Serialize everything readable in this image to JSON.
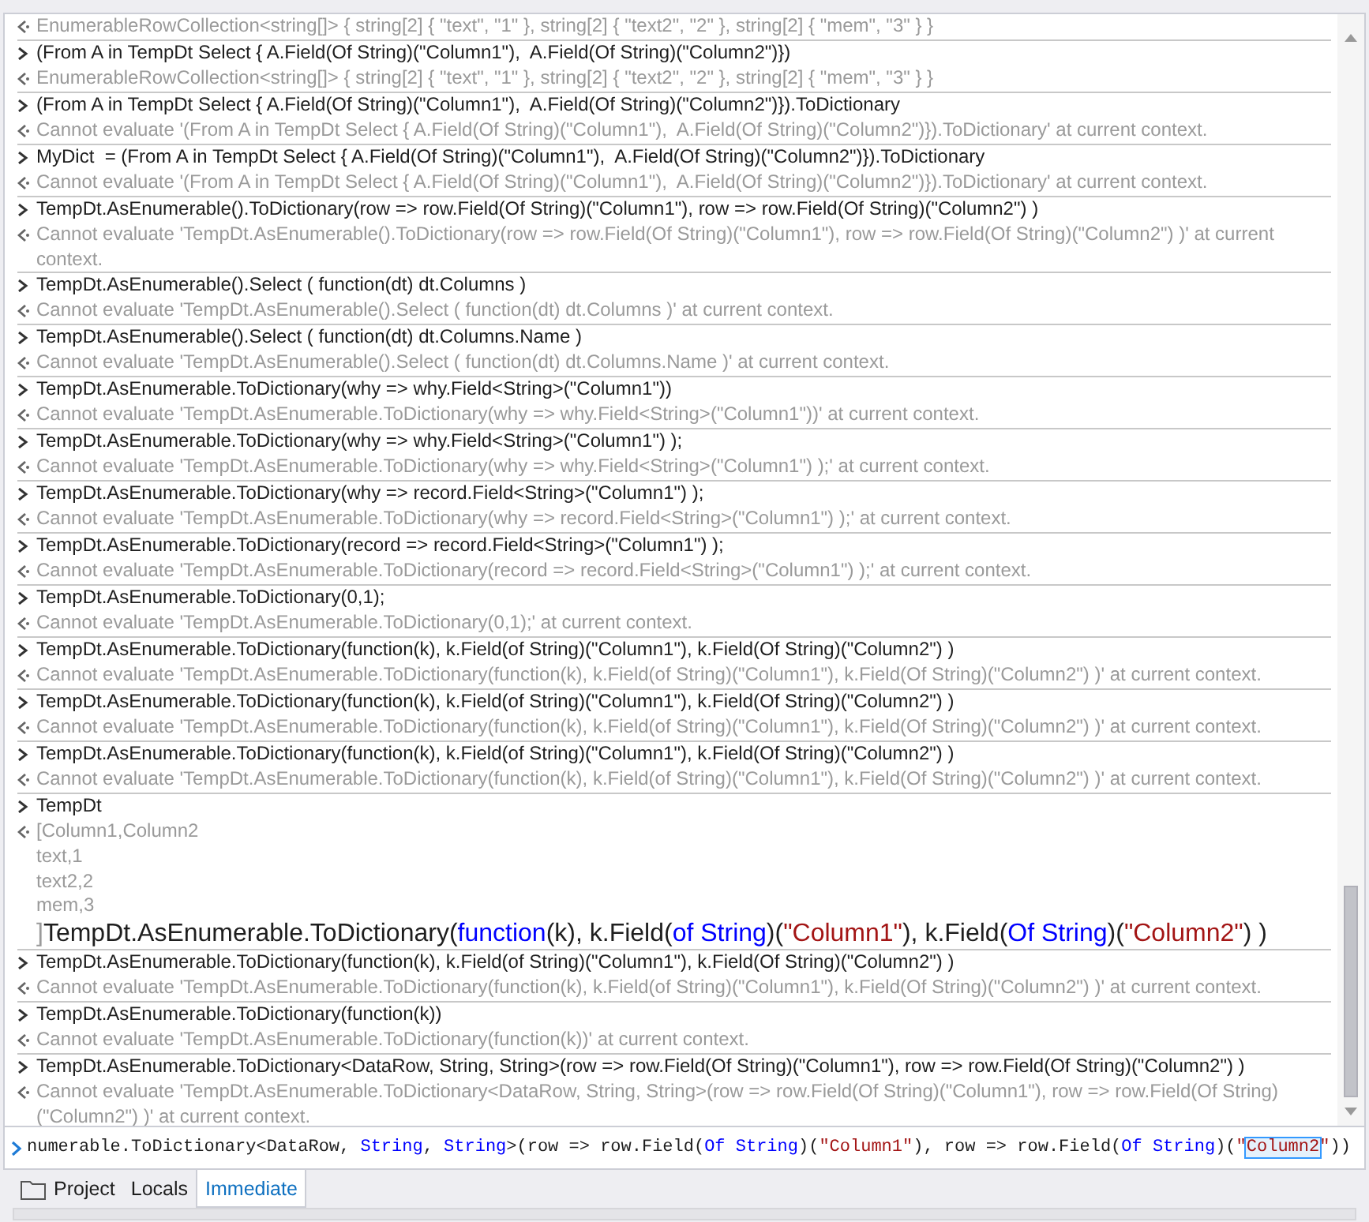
{
  "entries": [
    {
      "output": [
        "EnumerableRowCollection<string[]> { string[2] { \"text\", \"1\" }, string[2] { \"text2\", \"2\" }, string[2] { \"mem\", \"3\" } }"
      ]
    },
    {
      "input": "(From A in TempDt Select { A.Field(Of String)(\"Column1\"),  A.Field(Of String)(\"Column2\")})",
      "output": [
        "EnumerableRowCollection<string[]> { string[2] { \"text\", \"1\" }, string[2] { \"text2\", \"2\" }, string[2] { \"mem\", \"3\" } }"
      ]
    },
    {
      "input": "(From A in TempDt Select { A.Field(Of String)(\"Column1\"),  A.Field(Of String)(\"Column2\")}).ToDictionary",
      "output": [
        "Cannot evaluate '(From A in TempDt Select { A.Field(Of String)(\"Column1\"),  A.Field(Of String)(\"Column2\")}).ToDictionary' at current context."
      ]
    },
    {
      "input": "MyDict  = (From A in TempDt Select { A.Field(Of String)(\"Column1\"),  A.Field(Of String)(\"Column2\")}).ToDictionary",
      "output": [
        "Cannot evaluate '(From A in TempDt Select { A.Field(Of String)(\"Column1\"),  A.Field(Of String)(\"Column2\")}).ToDictionary' at current context."
      ]
    },
    {
      "input": "TempDt.AsEnumerable().ToDictionary(row => row.Field(Of String)(\"Column1\"), row => row.Field(Of String)(\"Column2\") )",
      "output": [
        "Cannot evaluate 'TempDt.AsEnumerable().ToDictionary(row => row.Field(Of String)(\"Column1\"), row => row.Field(Of String)(\"Column2\") )' at current context."
      ]
    },
    {
      "input": "TempDt.AsEnumerable().Select ( function(dt) dt.Columns )",
      "output": [
        "Cannot evaluate 'TempDt.AsEnumerable().Select ( function(dt) dt.Columns )' at current context."
      ]
    },
    {
      "input": "TempDt.AsEnumerable().Select ( function(dt) dt.Columns.Name )",
      "output": [
        "Cannot evaluate 'TempDt.AsEnumerable().Select ( function(dt) dt.Columns.Name )' at current context."
      ]
    },
    {
      "input": "TempDt.AsEnumerable.ToDictionary(why => why.Field<String>(\"Column1\"))",
      "output": [
        "Cannot evaluate 'TempDt.AsEnumerable.ToDictionary(why => why.Field<String>(\"Column1\"))' at current context."
      ]
    },
    {
      "input": "TempDt.AsEnumerable.ToDictionary(why => why.Field<String>(\"Column1\") );",
      "output": [
        "Cannot evaluate 'TempDt.AsEnumerable.ToDictionary(why => why.Field<String>(\"Column1\") );' at current context."
      ]
    },
    {
      "input": "TempDt.AsEnumerable.ToDictionary(why => record.Field<String>(\"Column1\") );",
      "output": [
        "Cannot evaluate 'TempDt.AsEnumerable.ToDictionary(why => record.Field<String>(\"Column1\") );' at current context."
      ]
    },
    {
      "input": "TempDt.AsEnumerable.ToDictionary(record => record.Field<String>(\"Column1\") );",
      "output": [
        "Cannot evaluate 'TempDt.AsEnumerable.ToDictionary(record => record.Field<String>(\"Column1\") );' at current context."
      ]
    },
    {
      "input": "TempDt.AsEnumerable.ToDictionary(0,1);",
      "output": [
        "Cannot evaluate 'TempDt.AsEnumerable.ToDictionary(0,1);' at current context."
      ]
    },
    {
      "input": "TempDt.AsEnumerable.ToDictionary(function(k), k.Field(of String)(\"Column1\"), k.Field(Of String)(\"Column2\") )",
      "output": [
        "Cannot evaluate 'TempDt.AsEnumerable.ToDictionary(function(k), k.Field(of String)(\"Column1\"), k.Field(Of String)(\"Column2\") )' at current context."
      ]
    },
    {
      "input": "TempDt.AsEnumerable.ToDictionary(function(k), k.Field(of String)(\"Column1\"), k.Field(Of String)(\"Column2\") )",
      "output": [
        "Cannot evaluate 'TempDt.AsEnumerable.ToDictionary(function(k), k.Field(of String)(\"Column1\"), k.Field(Of String)(\"Column2\") )' at current context."
      ]
    },
    {
      "input": "TempDt.AsEnumerable.ToDictionary(function(k), k.Field(of String)(\"Column1\"), k.Field(Of String)(\"Column2\") )",
      "output": [
        "Cannot evaluate 'TempDt.AsEnumerable.ToDictionary(function(k), k.Field(of String)(\"Column1\"), k.Field(Of String)(\"Column2\") )' at current context."
      ]
    },
    {
      "input": "TempDt",
      "output": [
        "[Column1,Column2",
        "text,1",
        "text2,2",
        "mem,3",
        "]"
      ],
      "pasted": [
        {
          "text": "TempDt.AsEnumerable.ToDictionary(",
          "kind": "plain"
        },
        {
          "text": "function",
          "kind": "keyword"
        },
        {
          "text": "(k), k.Field(",
          "kind": "plain"
        },
        {
          "text": "of String",
          "kind": "keyword"
        },
        {
          "text": ")(",
          "kind": "plain"
        },
        {
          "text": "\"Column1\"",
          "kind": "string"
        },
        {
          "text": "), k.Field(",
          "kind": "plain"
        },
        {
          "text": "Of String",
          "kind": "keyword"
        },
        {
          "text": ")(",
          "kind": "plain"
        },
        {
          "text": "\"Column2\"",
          "kind": "string"
        },
        {
          "text": ") )",
          "kind": "plain"
        }
      ]
    },
    {
      "input": "TempDt.AsEnumerable.ToDictionary(function(k), k.Field(of String)(\"Column1\"), k.Field(Of String)(\"Column2\") )",
      "output": [
        "Cannot evaluate 'TempDt.AsEnumerable.ToDictionary(function(k), k.Field(of String)(\"Column1\"), k.Field(Of String)(\"Column2\") )' at current context."
      ]
    },
    {
      "input": "TempDt.AsEnumerable.ToDictionary(function(k))",
      "output": [
        "Cannot evaluate 'TempDt.AsEnumerable.ToDictionary(function(k))' at current context."
      ]
    },
    {
      "input": "TempDt.AsEnumerable.ToDictionary<DataRow, String, String>(row => row.Field(Of String)(\"Column1\"), row => row.Field(Of String)(\"Column2\") )",
      "output": [
        "Cannot evaluate 'TempDt.AsEnumerable.ToDictionary<DataRow, String, String>(row => row.Field(Of String)(\"Column1\"), row => row.Field(Of String) (\"Column2\") )' at current context."
      ]
    }
  ],
  "input_line": [
    {
      "text": "numerable.ToDictionary<DataRow, ",
      "kind": "plain"
    },
    {
      "text": "String",
      "kind": "keyword"
    },
    {
      "text": ", ",
      "kind": "plain"
    },
    {
      "text": "String",
      "kind": "keyword"
    },
    {
      "text": ">(row => row.Field(",
      "kind": "plain"
    },
    {
      "text": "Of String",
      "kind": "keyword"
    },
    {
      "text": ")(",
      "kind": "plain"
    },
    {
      "text": "\"Column1\"",
      "kind": "string"
    },
    {
      "text": "), row => row.Field(",
      "kind": "plain"
    },
    {
      "text": "Of String",
      "kind": "keyword"
    },
    {
      "text": ")(",
      "kind": "plain"
    },
    {
      "text": "\"",
      "kind": "string"
    },
    {
      "text": "Column2",
      "kind": "string",
      "highlighted": true
    },
    {
      "text": "\"",
      "kind": "string"
    },
    {
      "text": "))",
      "kind": "plain"
    }
  ],
  "tabs": [
    {
      "label": "Project",
      "selected": false
    },
    {
      "label": "Locals",
      "selected": false
    },
    {
      "label": "Immediate",
      "selected": true
    }
  ]
}
